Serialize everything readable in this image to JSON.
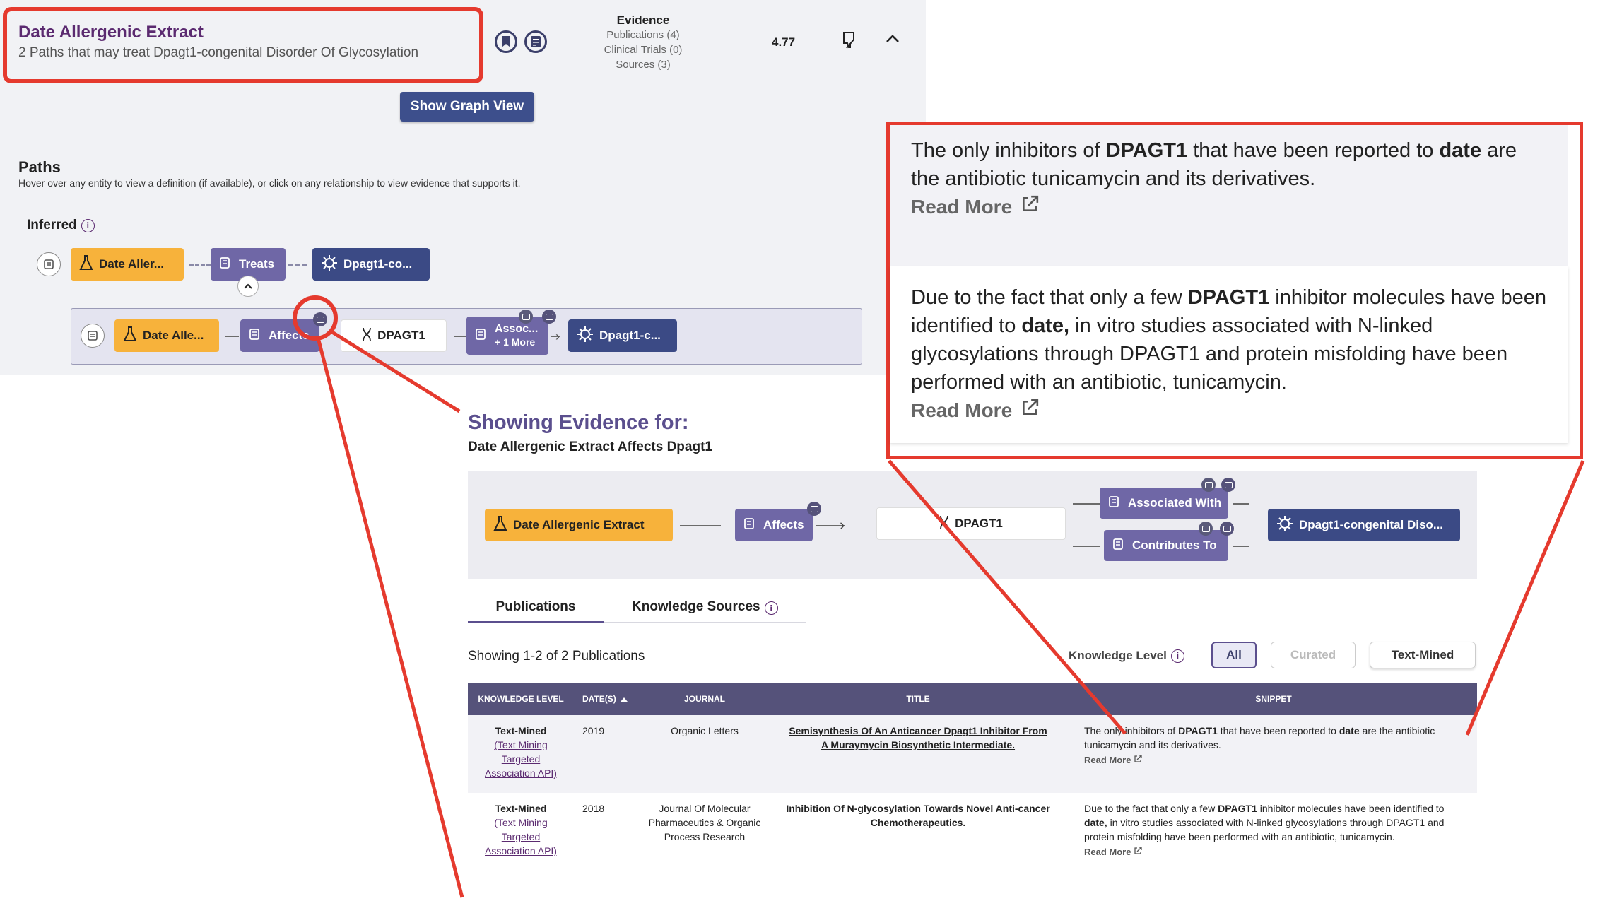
{
  "result": {
    "title": "Date Allergenic Extract",
    "subtitle": "2 Paths that may treat Dpagt1-congenital Disorder Of Glycosylation",
    "evidence_heading": "Evidence",
    "publications": "Publications (4)",
    "clinical_trials": "Clinical Trials (0)",
    "sources": "Sources (3)",
    "score": "4.77",
    "icons": [
      "bookmark-icon",
      "notes-icon",
      "thumbs-down-icon",
      "chevron-up-icon"
    ]
  },
  "show_graph_label": "Show Graph View",
  "paths": {
    "heading": "Paths",
    "subheading": "Hover over any entity to view a definition (if available), or click on any relationship to view evidence that supports it.",
    "inferred_label": "Inferred",
    "path1": {
      "drug": "Date Aller...",
      "rel": "Treats",
      "disease": "Dpagt1-co..."
    },
    "path2": {
      "drug": "Date Alle...",
      "rel1": "Affects",
      "gene": "DPAGT1",
      "rel2": "Assoc...",
      "rel2_more": "+ 1 More",
      "disease": "Dpagt1-c..."
    }
  },
  "evidence": {
    "heading": "Showing Evidence for:",
    "subheading": "Date Allergenic Extract Affects Dpagt1",
    "graph": {
      "drug": "Date Allergenic Extract",
      "rel": "Affects",
      "gene": "DPAGT1",
      "rel_a": "Associated With",
      "rel_b": "Contributes To",
      "disease": "Dpagt1-congenital Diso..."
    },
    "tabs": [
      "Publications",
      "Knowledge Sources"
    ],
    "showing": "Showing 1-2 of 2 Publications",
    "knowledge_level_label": "Knowledge Level",
    "filters": [
      "All",
      "Curated",
      "Text-Mined"
    ],
    "columns": [
      "Knowledge Level",
      "Date(s)",
      "Journal",
      "Title",
      "Snippet"
    ],
    "rows": [
      {
        "level": "Text-Mined",
        "level_source": "(Text Mining Targeted Association API)",
        "date": "2019",
        "journal": "Organic Letters",
        "title": "Semisynthesis Of An Anticancer Dpagt1 Inhibitor From A Muraymycin Biosynthetic Intermediate.",
        "snippet_pre": "The only inhibitors of ",
        "snippet_b1": "DPAGT1",
        "snippet_mid": " that have been reported to ",
        "snippet_b2": "date",
        "snippet_post": " are the antibiotic tunicamycin and its derivatives.",
        "read_more": "Read More"
      },
      {
        "level": "Text-Mined",
        "level_source": "(Text Mining Targeted Association API)",
        "date": "2018",
        "journal": "Journal Of Molecular Pharmaceutics & Organic Process Research",
        "title": "Inhibition Of N-glycosylation Towards Novel Anti-cancer Chemotherapeutics.",
        "snippet_pre": "Due to the fact that only a few ",
        "snippet_b1": "DPAGT1",
        "snippet_mid": " inhibitor molecules have been identified to ",
        "snippet_b2": "date,",
        "snippet_post": " in vitro studies associated with N-linked glycosylations through DPAGT1 and protein misfolding have been performed with an antibiotic, tunicamycin.",
        "read_more": "Read More"
      }
    ]
  },
  "colors": {
    "accent_purple": "#5b2a70",
    "relation": "#6f67a6",
    "disease": "#3b4a85",
    "drug": "#f7b23b",
    "callout_red": "#e53a2e",
    "table_header": "#55527a"
  }
}
